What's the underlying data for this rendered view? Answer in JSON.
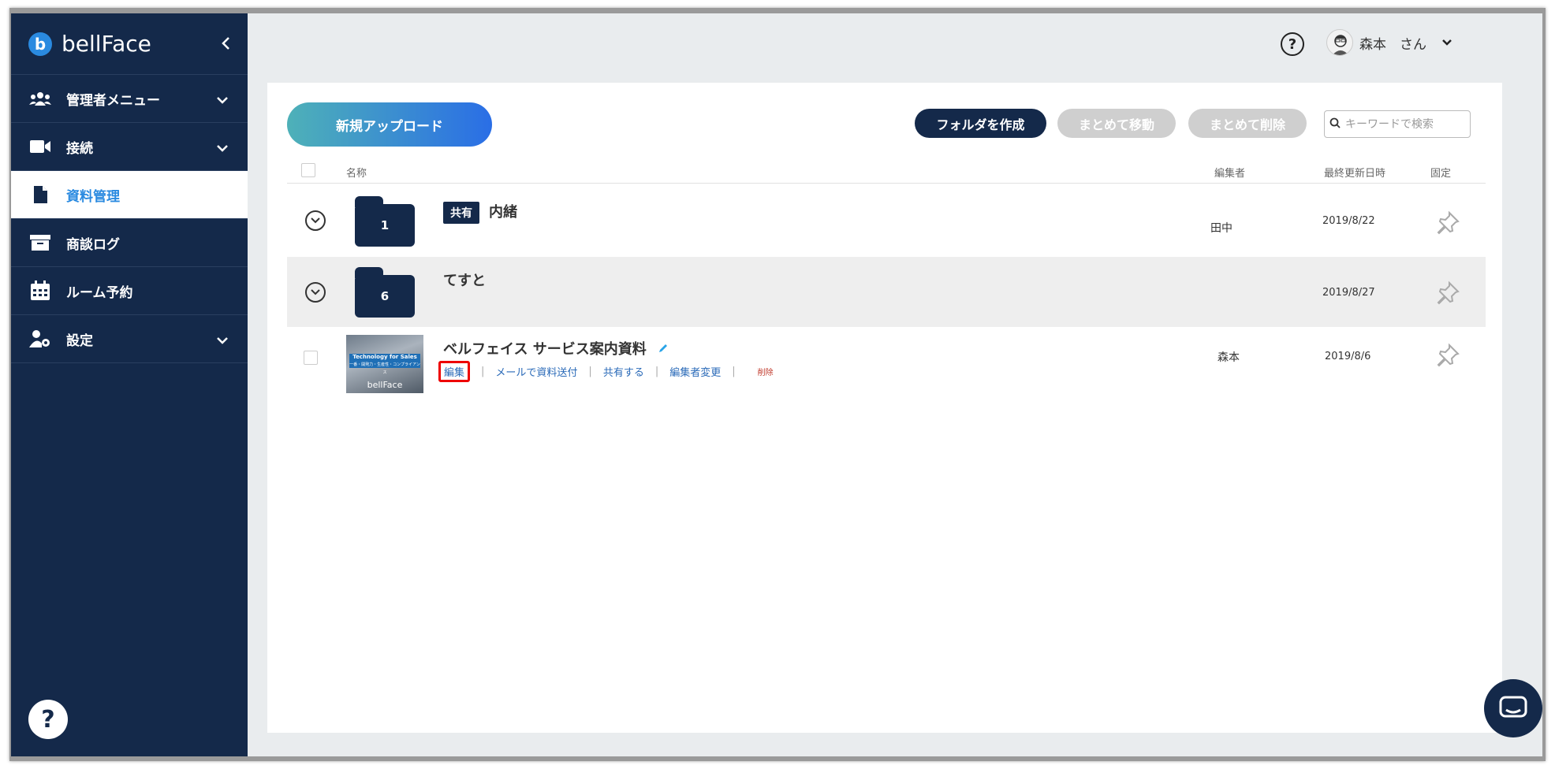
{
  "brand": {
    "name": "bellFace",
    "logo_letter": "b"
  },
  "sidebar": {
    "items": [
      {
        "label": "管理者メニュー",
        "icon": "users-icon",
        "has_chevron": true
      },
      {
        "label": "接続",
        "icon": "video-camera-icon",
        "has_chevron": true
      },
      {
        "label": "資料管理",
        "icon": "document-icon",
        "active": true
      },
      {
        "label": "商談ログ",
        "icon": "archive-box-icon"
      },
      {
        "label": "ルーム予約",
        "icon": "calendar-icon"
      },
      {
        "label": "設定",
        "icon": "user-gear-icon",
        "has_chevron": true
      }
    ],
    "help_glyph": "?"
  },
  "topbar": {
    "help_glyph": "?",
    "user_name": "森本　さん"
  },
  "toolbar": {
    "upload_label": "新規アップロード",
    "create_folder_label": "フォルダを作成",
    "bulk_move_label": "まとめて移動",
    "bulk_delete_label": "まとめて削除",
    "search_placeholder": "キーワードで検索"
  },
  "table": {
    "headers": {
      "name": "名称",
      "editor": "編集者",
      "updated": "最終更新日時",
      "pin": "固定"
    },
    "rows": [
      {
        "type": "folder",
        "count": "1",
        "badge": "共有",
        "name": "内緒",
        "editor": "田中",
        "updated": "2019/8/22"
      },
      {
        "type": "folder",
        "count": "6",
        "name": "てすと",
        "editor": "",
        "updated": "2019/8/27"
      },
      {
        "type": "file",
        "name": "ベルフェイス サービス案内資料",
        "editor": "森本",
        "updated": "2019/8/6",
        "thumb_title": "Technology for Sales",
        "thumb_sub": "一番・開発力・生産性・コンプライアンス",
        "thumb_logo": "bellFace",
        "actions": {
          "edit": "編集",
          "mail": "メールで資料送付",
          "share": "共有する",
          "change_editor": "編集者変更",
          "delete": "削除"
        }
      }
    ]
  },
  "colors": {
    "sidebar": "#14294a",
    "accent": "#2a8ae0",
    "highlight": "#e00000"
  }
}
